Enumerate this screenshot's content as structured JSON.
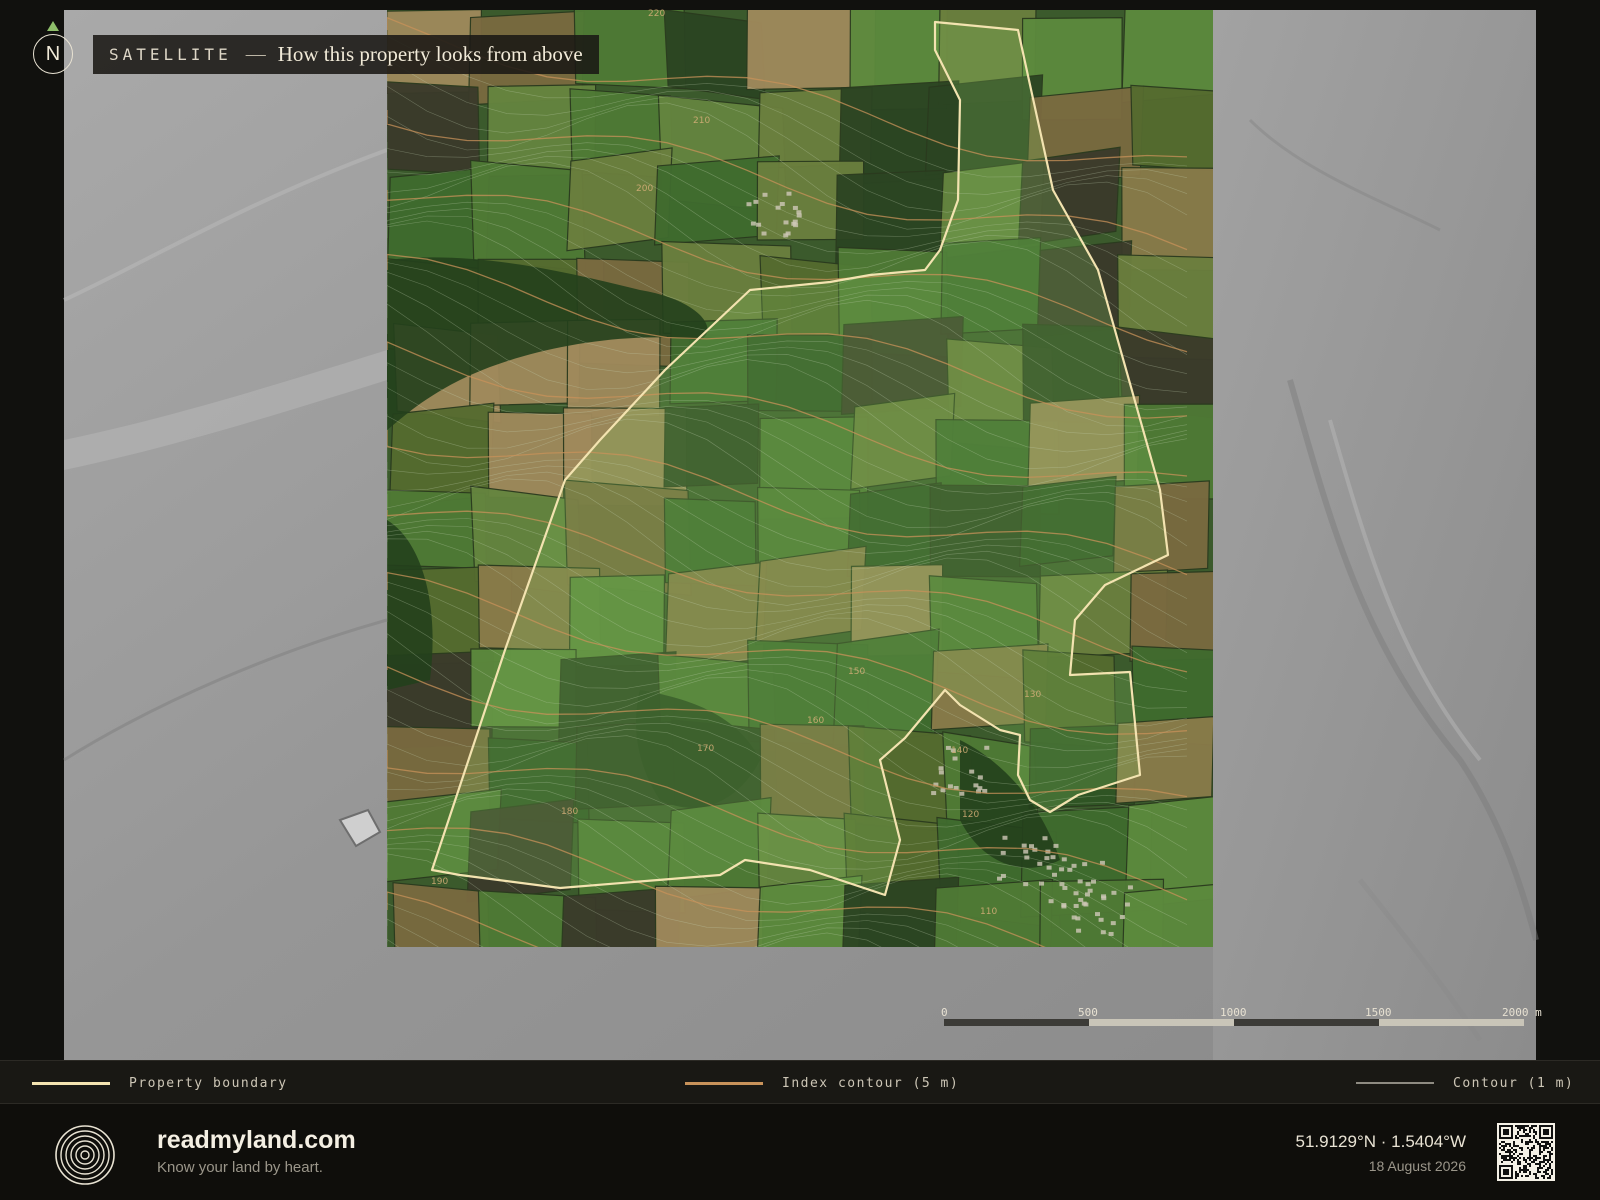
{
  "header": {
    "kicker": "SATELLITE",
    "separator": "—",
    "title": "How this property looks from above"
  },
  "compass": {
    "label": "N",
    "icon": "north-arrow-icon",
    "arrow_color": "#8fbf6a"
  },
  "scale_bar": {
    "ticks": [
      "0",
      "500",
      "1000",
      "1500",
      "2000 m"
    ]
  },
  "contour_labels": [
    "220",
    "210",
    "200",
    "190",
    "180",
    "170",
    "160",
    "150",
    "140",
    "130",
    "120",
    "110"
  ],
  "legend": {
    "boundary": {
      "label": "Property boundary",
      "color": "#f3e3b0"
    },
    "index_contour": {
      "label": "Index contour (5 m)",
      "color": "#c8925a"
    },
    "contour": {
      "label": "Contour (1 m)",
      "color": "#8e8b82"
    }
  },
  "footer": {
    "brand": "readmyland.com",
    "tagline": "Know your land by heart.",
    "coordinates": "51.9129°N · 1.5404°W",
    "date": "18 August 2026",
    "logo_icon": "concentric-rings-logo",
    "qr_icon": "qr-code-icon"
  }
}
